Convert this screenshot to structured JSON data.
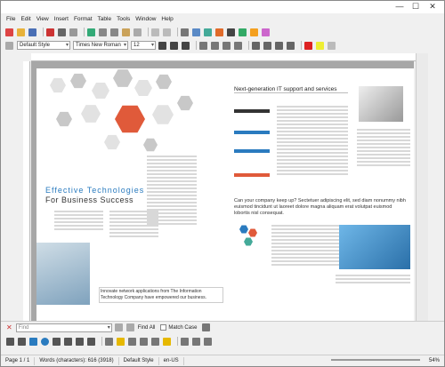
{
  "menu": [
    "File",
    "Edit",
    "View",
    "Insert",
    "Format",
    "Table",
    "Tools",
    "Window",
    "Help"
  ],
  "format": {
    "style": "Default Style",
    "font": "Times New Roman",
    "size": "12"
  },
  "doc": {
    "heading1": "Next-generation IT support and services",
    "title_effective": "Effective Technologies",
    "title_business": "For Business Success",
    "company_slogan": "Can your company keep up? Sectetuer adipiscing elit, sed diam nonummy nibh euismod tincidunt ut laoreet dolore magna aliquam erat volutpat euismod lobortis nisl consequat.",
    "innovate": "Innovate network applications from The Information Technology Company have empowered our business."
  },
  "findbar": {
    "placeholder": "Find",
    "find_all": "Find All",
    "match_case": "Match Case"
  },
  "status": {
    "page": "Page 1 / 1",
    "words": "Words (characters): 616 (3918)",
    "style": "Default Style",
    "lang": "en-US",
    "zoom": "54%"
  },
  "colors": {
    "orange": "#e05a3a",
    "accent_blue": "#2a7bbf"
  }
}
